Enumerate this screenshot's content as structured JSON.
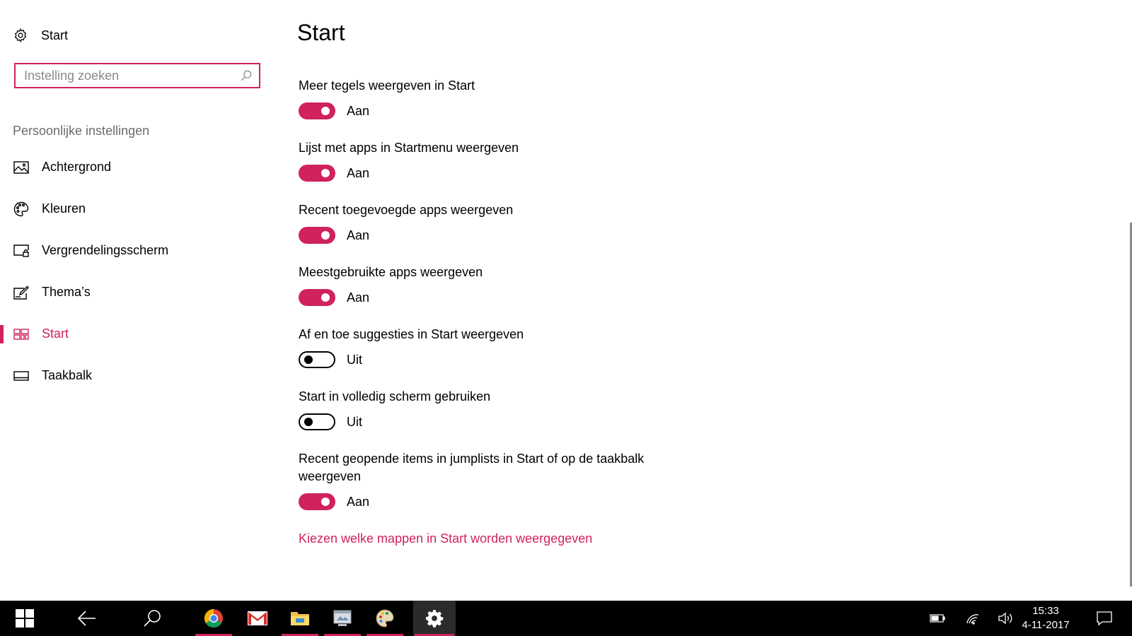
{
  "sidebar": {
    "app_title": "Start",
    "search_placeholder": "Instelling zoeken",
    "section_title": "Persoonlijke instellingen",
    "items": [
      {
        "label": "Achtergrond",
        "icon": "image-icon"
      },
      {
        "label": "Kleuren",
        "icon": "palette-icon"
      },
      {
        "label": "Vergrendelingsscherm",
        "icon": "lock-screen-icon"
      },
      {
        "label": "Thema’s",
        "icon": "themes-icon"
      },
      {
        "label": "Start",
        "icon": "start-tiles-icon",
        "active": true
      },
      {
        "label": "Taakbalk",
        "icon": "taskbar-icon"
      }
    ]
  },
  "main": {
    "title": "Start",
    "settings": [
      {
        "title": "Meer tegels weergeven in Start",
        "on": true,
        "state": "Aan"
      },
      {
        "title": "Lijst met apps in Startmenu weergeven",
        "on": true,
        "state": "Aan"
      },
      {
        "title": "Recent toegevoegde apps weergeven",
        "on": true,
        "state": "Aan"
      },
      {
        "title": "Meestgebruikte apps weergeven",
        "on": true,
        "state": "Aan"
      },
      {
        "title": "Af en toe suggesties in Start weergeven",
        "on": false,
        "state": "Uit"
      },
      {
        "title": "Start in volledig scherm gebruiken",
        "on": false,
        "state": "Uit"
      },
      {
        "title": "Recent geopende items in jumplists in Start of op de taakbalk weergeven",
        "on": true,
        "state": "Aan"
      }
    ],
    "link": "Kiezen welke mappen in Start worden weergegeven"
  },
  "taskbar": {
    "time": "15:33",
    "date": "4-11-2017"
  },
  "colors": {
    "accent": "#d0225b",
    "taskbar": "#000000",
    "secondary_text": "#6b6b6b"
  }
}
